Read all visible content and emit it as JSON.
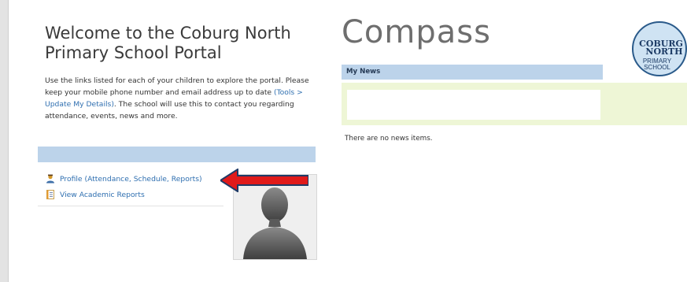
{
  "welcome": {
    "title": "Welcome to the Coburg North Primary School Portal",
    "intro_part1": "Use the links listed for each of your children to explore the portal. Please keep your mobile phone number and email address up to date ",
    "intro_link": "(Tools > Update My Details)",
    "intro_part2": ". The school will use this to contact you regarding attendance, events, news and more."
  },
  "child_links": [
    {
      "label": "Profile (Attendance, Schedule, Reports)",
      "icon": "person-icon"
    },
    {
      "label": "View Academic Reports",
      "icon": "report-icon"
    }
  ],
  "brand": {
    "name": "Compass"
  },
  "logo": {
    "line1": "COBURG",
    "line2": "NORTH",
    "line3": "PRIMARY",
    "line4": "SCHOOL"
  },
  "news": {
    "header": "My News",
    "empty_text": "There are no news items."
  },
  "colors": {
    "header_blue": "#bcd3ea",
    "link_blue": "#2f6fb0",
    "news_band": "#eef6d6",
    "arrow_red": "#e01a1a"
  }
}
